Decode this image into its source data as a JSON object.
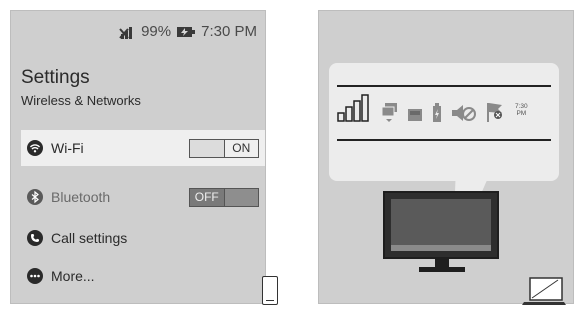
{
  "phone": {
    "status": {
      "battery": "99%",
      "time": "7:30 PM"
    },
    "title": "Settings",
    "subtitle": "Wireless & Networks",
    "items": [
      {
        "label": "Wi-Fi",
        "icon": "wifi-icon",
        "toggle": {
          "left": "",
          "right": "ON"
        }
      },
      {
        "label": "Bluetooth",
        "icon": "bluetooth-icon",
        "toggle": {
          "left": "OFF",
          "right": ""
        }
      },
      {
        "label": "Call settings",
        "icon": "phone-call-icon"
      },
      {
        "label": "More...",
        "icon": "more-dots-icon"
      }
    ]
  },
  "pc": {
    "tray_time": {
      "line1": "7:30",
      "line2": "PM"
    }
  },
  "colors": {
    "panel": "#cfcfcf",
    "callout": "#ececec",
    "highlight_row": "#efefef"
  }
}
